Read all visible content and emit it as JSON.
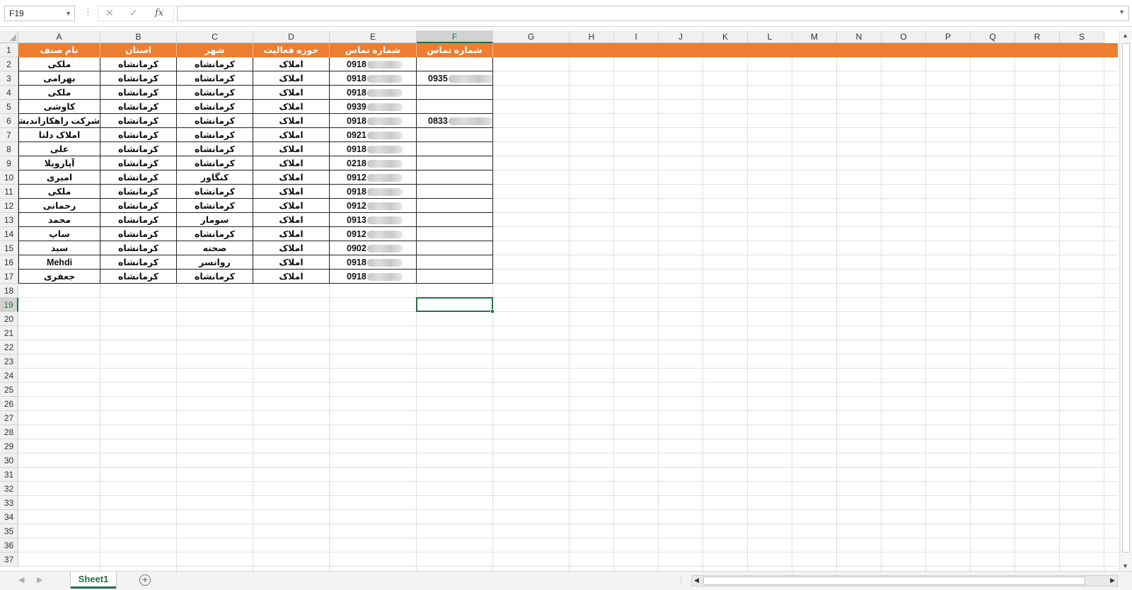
{
  "formula_bar": {
    "name_box": "F19",
    "cancel_icon": "close-icon",
    "enter_icon": "check-icon",
    "function_label": "fx",
    "formula_value": ""
  },
  "columns": [
    "A",
    "B",
    "C",
    "D",
    "E",
    "F",
    "G",
    "H",
    "I",
    "J",
    "K",
    "L",
    "M",
    "N",
    "O",
    "P",
    "Q",
    "R",
    "S"
  ],
  "selected_column": "F",
  "selected_row": 19,
  "header_row": [
    "نام صنف",
    "استان",
    "شهر",
    "حوزه فعالیت",
    "شماره تماس",
    "شماره تماس"
  ],
  "data_rows": [
    {
      "name": "ملکی",
      "province": "کرمانشاه",
      "city": "کرمانشاه",
      "field": "املاک",
      "phone": "0918",
      "phone2": ""
    },
    {
      "name": "بهرامی",
      "province": "کرمانشاه",
      "city": "کرمانشاه",
      "field": "املاک",
      "phone": "0918",
      "phone2": "0935"
    },
    {
      "name": "ملکی",
      "province": "کرمانشاه",
      "city": "کرمانشاه",
      "field": "املاک",
      "phone": "0918",
      "phone2": ""
    },
    {
      "name": "کاوشی",
      "province": "کرمانشاه",
      "city": "کرمانشاه",
      "field": "املاک",
      "phone": "0939",
      "phone2": ""
    },
    {
      "name": "شرکت راهکاراندیشان",
      "province": "کرمانشاه",
      "city": "کرمانشاه",
      "field": "املاک",
      "phone": "0918",
      "phone2": "0833"
    },
    {
      "name": "املاک دلتا",
      "province": "کرمانشاه",
      "city": "کرمانشاه",
      "field": "املاک",
      "phone": "0921",
      "phone2": ""
    },
    {
      "name": "علی",
      "province": "کرمانشاه",
      "city": "کرمانشاه",
      "field": "املاک",
      "phone": "0918",
      "phone2": ""
    },
    {
      "name": "آپارویلا",
      "province": "کرمانشاه",
      "city": "کرمانشاه",
      "field": "املاک",
      "phone": "0218",
      "phone2": ""
    },
    {
      "name": "امیری",
      "province": "کرمانشاه",
      "city": "کنگاور",
      "field": "املاک",
      "phone": "0912",
      "phone2": ""
    },
    {
      "name": "ملکی",
      "province": "کرمانشاه",
      "city": "کرمانشاه",
      "field": "املاک",
      "phone": "0918",
      "phone2": ""
    },
    {
      "name": "رحمانی",
      "province": "کرمانشاه",
      "city": "کرمانشاه",
      "field": "املاک",
      "phone": "0912",
      "phone2": ""
    },
    {
      "name": "محمد",
      "province": "کرمانشاه",
      "city": "سومار",
      "field": "املاک",
      "phone": "0913",
      "phone2": ""
    },
    {
      "name": "ساپ",
      "province": "کرمانشاه",
      "city": "کرمانشاه",
      "field": "املاک",
      "phone": "0912",
      "phone2": ""
    },
    {
      "name": "سید",
      "province": "کرمانشاه",
      "city": "صحنه",
      "field": "املاک",
      "phone": "0902",
      "phone2": ""
    },
    {
      "name": "Mehdi",
      "province": "کرمانشاه",
      "city": "روانسر",
      "field": "املاک",
      "phone": "0918",
      "phone2": ""
    },
    {
      "name": "جعفری",
      "province": "کرمانشاه",
      "city": "کرمانشاه",
      "field": "املاک",
      "phone": "0918",
      "phone2": ""
    }
  ],
  "row_count": 37,
  "sheet_tab": "Sheet1",
  "add_sheet_icon": "plus-circle-icon",
  "colors": {
    "header_fill": "#ed7d31",
    "accent": "#217346"
  }
}
